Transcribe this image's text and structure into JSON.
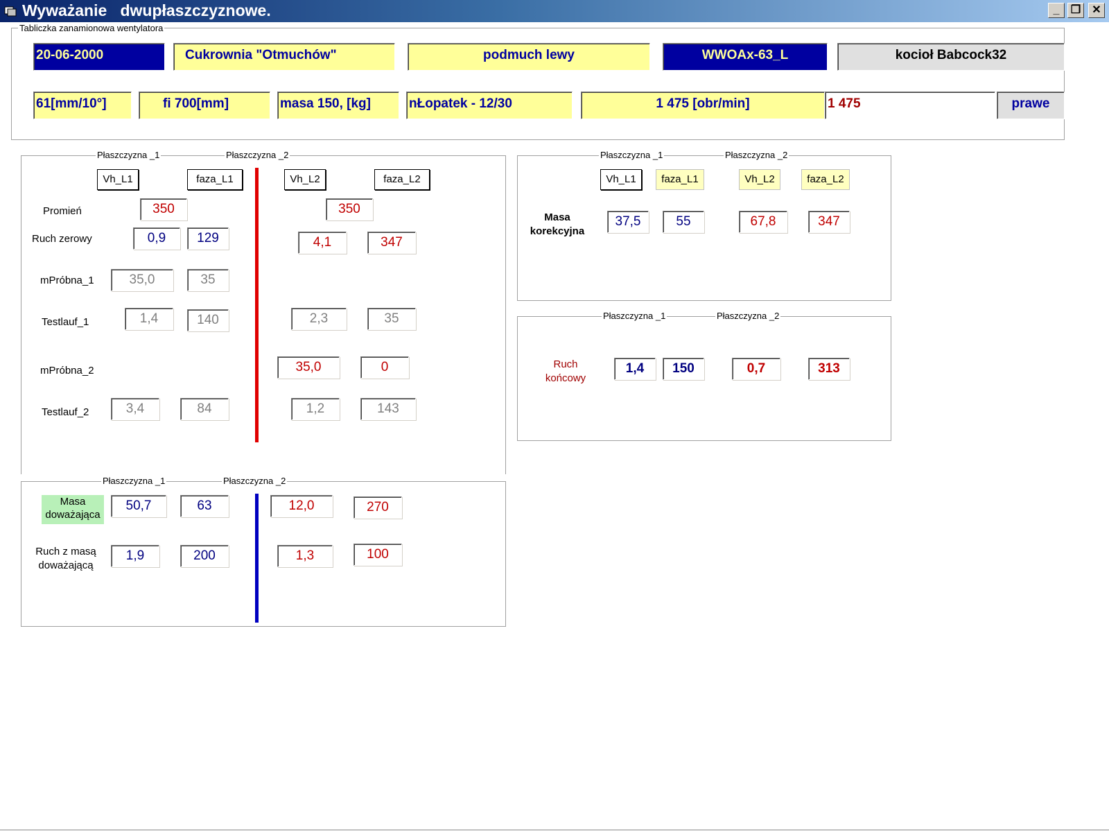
{
  "window": {
    "title": "Wyważanie   dwupłaszczyznowe.",
    "minimize": "_",
    "restore": "❐",
    "close": "✕"
  },
  "nameplate": {
    "legend": "Tabliczka zanamionowa wentylatora",
    "date": "20-06-2000",
    "plant": "Cukrownia \"Otmuchów\"",
    "fan": "podmuch lewy",
    "model": "WWOAx-63_L",
    "boiler": "kocioł Babcock32",
    "scale": "61[mm/10°]",
    "diameter": "fi    700[mm]",
    "mass": "masa  150, [kg]",
    "blades": "nŁopatek -  12/30",
    "speed": "1 475 [obr/min]",
    "speed_input": "1 475",
    "direction_button": "prawe"
  },
  "main_panel": {
    "plane1": "Płaszczyzna _1",
    "plane2": "Płaszczyzna _2",
    "col_vh_l1": "Vh_L1",
    "col_faza_l1": "faza_L1",
    "col_vh_l2": "Vh_L2",
    "col_faza_l2": "faza_L2",
    "row_promien": "Promień",
    "promien_l1": "350",
    "promien_l2": "350",
    "row_ruch_zerowy": "Ruch zerowy",
    "rz_vh_l1": "0,9",
    "rz_faza_l1": "129",
    "rz_vh_l2": "4,1",
    "rz_faza_l2": "347",
    "row_mprobna1": "mPróbna_1",
    "mp1_vh": "35,0",
    "mp1_faza": "35",
    "row_testlauf1": "Testlauf_1",
    "tl1_vh_l1": "1,4",
    "tl1_faza_l1": "140",
    "tl1_vh_l2": "2,3",
    "tl1_faza_l2": "35",
    "row_mprobna2": "mPróbna_2",
    "mp2_vh": "35,0",
    "mp2_faza": "0",
    "row_testlauf2": "Testlauf_2",
    "tl2_vh_l1": "3,4",
    "tl2_faza_l1": "84",
    "tl2_vh_l2": "1,2",
    "tl2_faza_l2": "143"
  },
  "counter_panel": {
    "plane1": "Płaszczyzna _1",
    "plane2": "Płaszczyzna _2",
    "row_masa": "Masa doważająca",
    "m_vh_l1": "50,7",
    "m_faza_l1": "63",
    "m_vh_l2": "12,0",
    "m_faza_l2": "270",
    "row_ruch": "Ruch z masą doważającą",
    "r_vh_l1": "1,9",
    "r_faza_l1": "200",
    "r_vh_l2": "1,3",
    "r_faza_l2": "100"
  },
  "correction_panel": {
    "plane1": "Płaszczyzna _1",
    "plane2": "Płaszczyzna _2",
    "col_vh_l1": "Vh_L1",
    "col_faza_l1": "faza_L1",
    "col_vh_l2": "Vh_L2",
    "col_faza_l2": "faza_L2",
    "row_label": "Masa korekcyjna",
    "vh_l1": "37,5",
    "faza_l1": "55",
    "vh_l2": "67,8",
    "faza_l2": "347"
  },
  "final_panel": {
    "plane1": "Płaszczyzna _1",
    "plane2": "Płaszczyzna _2",
    "row_label": "Ruch końcowy",
    "vh_l1": "1,4",
    "faza_l1": "150",
    "vh_l2": "0,7",
    "faza_l2": "313"
  },
  "colors": {
    "title_start": "#0a246a",
    "field_yellow": "#ffff99",
    "field_navy": "#0000a0",
    "value_red": "#c00000",
    "value_blue": "#000080",
    "divider_red": "#e00000",
    "divider_blue": "#0000c0",
    "label_green": "#b8f0b8"
  }
}
